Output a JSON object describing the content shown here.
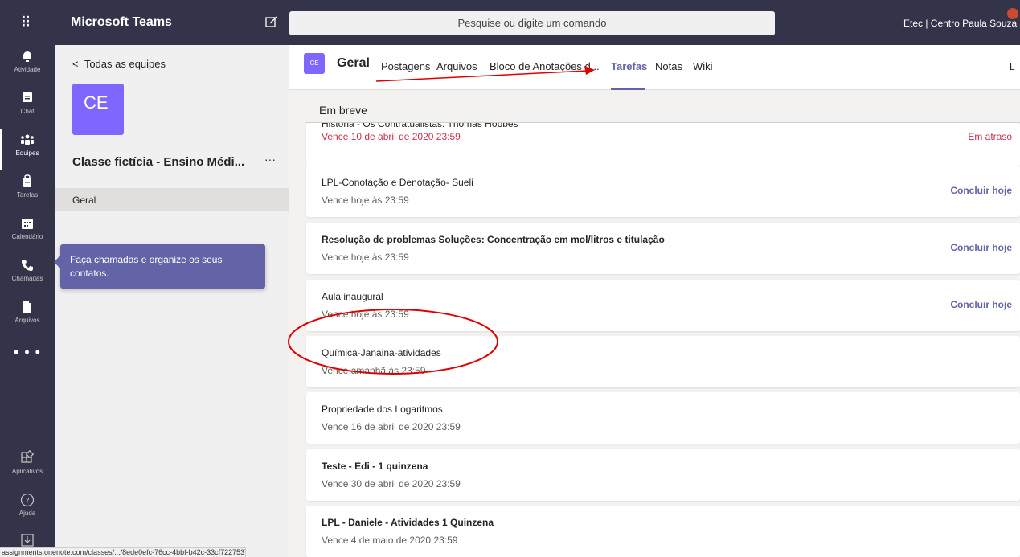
{
  "topbar": {
    "app_name": "Microsoft Teams",
    "search_placeholder": "Pesquise ou digite um comando",
    "org_name": "Etec | Centro Paula Souza"
  },
  "rail": {
    "items": [
      {
        "label": "Atividade",
        "icon": "bell-icon"
      },
      {
        "label": "Chat",
        "icon": "chat-icon"
      },
      {
        "label": "Equipes",
        "icon": "teams-icon"
      },
      {
        "label": "Tarefas",
        "icon": "assignments-icon"
      },
      {
        "label": "Calendário",
        "icon": "calendar-icon"
      },
      {
        "label": "Chamadas",
        "icon": "phone-icon"
      },
      {
        "label": "Arquivos",
        "icon": "files-icon"
      }
    ],
    "more": "• • •",
    "bottom": [
      {
        "label": "Aplicativos",
        "icon": "apps-icon"
      },
      {
        "label": "Ajuda",
        "icon": "help-icon"
      }
    ]
  },
  "teams_panel": {
    "back_label": "Todas as equipes",
    "avatar_initials": "CE",
    "team_title": "Classe fictícia - Ensino Médi...",
    "more": "···",
    "channel": "Geral"
  },
  "tooltip": {
    "text": "Faça chamadas e organize os seus contatos."
  },
  "header": {
    "avatar_initials": "CE",
    "channel_name": "Geral",
    "tabs": [
      "Postagens",
      "Arquivos",
      "Bloco de Anotações d...",
      "Tarefas",
      "Notas",
      "Wiki"
    ],
    "active_tab": "Tarefas",
    "truncated": "L"
  },
  "section": {
    "title": "Em breve"
  },
  "assignments": [
    {
      "title": "História - Os Contratualistas: Thomas Hobbes",
      "due": "Vence 10 de abril de 2020 23:59",
      "status": "Em atraso",
      "bold": false
    },
    {
      "title": "LPL-Conotação e Denotação- Sueli",
      "due": "Vence hoje às 23:59",
      "status": "Concluir hoje",
      "bold": false
    },
    {
      "title": "Resolução de problemas Soluções: Concentração em mol/litros e titulação",
      "due": "Vence hoje às 23:59",
      "status": "Concluir hoje",
      "bold": true
    },
    {
      "title": "Aula inaugural",
      "due": "Vence hoje às 23:59",
      "status": "Concluir hoje",
      "bold": false
    },
    {
      "title": "Química-Janaina-atividades",
      "due": "Vence amanhã às 23:59",
      "status": "",
      "bold": false
    },
    {
      "title": "Propriedade dos Logaritmos",
      "due": "Vence 16 de abril de 2020 23:59",
      "status": "",
      "bold": false
    },
    {
      "title": "Teste - Edi - 1 quinzena",
      "due": "Vence 30 de abril de 2020 23:59",
      "status": "",
      "bold": true
    },
    {
      "title": "LPL - Daniele - Atividades 1 Quinzena",
      "due": "Vence 4 de maio de 2020 23:59",
      "status": "",
      "bold": true
    }
  ],
  "statusbar": {
    "url": "assignments.onenote.com/classes/.../8ede0efc-76cc-4bbf-b42c-33cf7227537f?returnP..."
  },
  "colors": {
    "rail_bg": "#33344a",
    "accent": "#6264a7",
    "brand_purple": "#7f66ff",
    "late_red": "#c4314b",
    "annotation_red": "#e00000"
  }
}
